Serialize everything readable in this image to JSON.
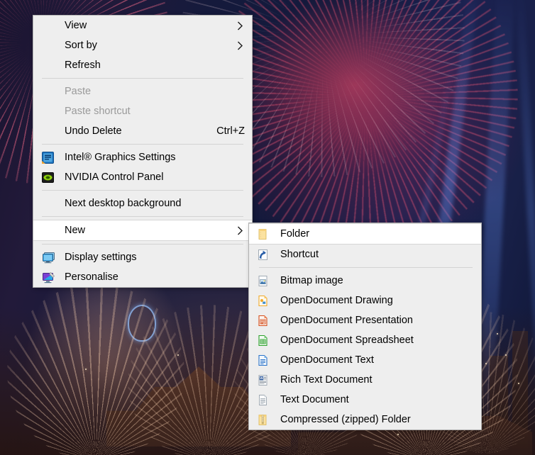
{
  "desktop": {
    "wallpaper_description": "Fireworks over illuminated riverside temple at night",
    "sky_color": "#151a3c",
    "firework_red": "#ff5a78",
    "firework_gold": "#ffd6b4",
    "beam_color": "#6996fa"
  },
  "context_menu": {
    "name": "desktop-context-menu",
    "background": "#eeeeee",
    "border_color": "#b1b1b1",
    "groups": [
      {
        "items": [
          {
            "label": "View",
            "icon": "none",
            "submenu": true,
            "disabled": false,
            "accel": ""
          },
          {
            "label": "Sort by",
            "icon": "none",
            "submenu": true,
            "disabled": false,
            "accel": ""
          },
          {
            "label": "Refresh",
            "icon": "none",
            "submenu": false,
            "disabled": false,
            "accel": ""
          }
        ]
      },
      {
        "items": [
          {
            "label": "Paste",
            "icon": "none",
            "submenu": false,
            "disabled": true,
            "accel": ""
          },
          {
            "label": "Paste shortcut",
            "icon": "none",
            "submenu": false,
            "disabled": true,
            "accel": ""
          },
          {
            "label": "Undo Delete",
            "icon": "none",
            "submenu": false,
            "disabled": false,
            "accel": "Ctrl+Z"
          }
        ]
      },
      {
        "items": [
          {
            "label": "Intel® Graphics Settings",
            "icon": "intel-graphics-icon",
            "submenu": false,
            "disabled": false,
            "accel": ""
          },
          {
            "label": "NVIDIA Control Panel",
            "icon": "nvidia-icon",
            "submenu": false,
            "disabled": false,
            "accel": ""
          }
        ]
      },
      {
        "items": [
          {
            "label": "Next desktop background",
            "icon": "none",
            "submenu": false,
            "disabled": false,
            "accel": ""
          }
        ]
      },
      {
        "items": [
          {
            "label": "New",
            "icon": "none",
            "submenu": true,
            "disabled": false,
            "accel": "",
            "highlighted": true
          }
        ]
      },
      {
        "items": [
          {
            "label": "Display settings",
            "icon": "display-settings-icon",
            "submenu": false,
            "disabled": false,
            "accel": ""
          },
          {
            "label": "Personalise",
            "icon": "personalise-icon",
            "submenu": false,
            "disabled": false,
            "accel": ""
          }
        ]
      }
    ]
  },
  "new_submenu": {
    "name": "new-submenu",
    "background": "#eeeeee",
    "groups": [
      {
        "items": [
          {
            "label": "Folder",
            "icon": "folder-icon",
            "highlighted": true
          },
          {
            "label": "Shortcut",
            "icon": "shortcut-icon",
            "highlighted": false
          }
        ]
      },
      {
        "items": [
          {
            "label": "Bitmap image",
            "icon": "bitmap-image-icon",
            "highlighted": false
          },
          {
            "label": "OpenDocument Drawing",
            "icon": "opendocument-drawing-icon",
            "highlighted": false
          },
          {
            "label": "OpenDocument Presentation",
            "icon": "opendocument-presentation-icon",
            "highlighted": false
          },
          {
            "label": "OpenDocument Spreadsheet",
            "icon": "opendocument-spreadsheet-icon",
            "highlighted": false
          },
          {
            "label": "OpenDocument Text",
            "icon": "opendocument-text-icon",
            "highlighted": false
          },
          {
            "label": "Rich Text Document",
            "icon": "rich-text-document-icon",
            "highlighted": false
          },
          {
            "label": "Text Document",
            "icon": "text-document-icon",
            "highlighted": false
          },
          {
            "label": "Compressed (zipped) Folder",
            "icon": "compressed-folder-icon",
            "highlighted": false
          }
        ]
      }
    ]
  },
  "icon_colors": {
    "folder": "#ffd98a",
    "shortcut_arrow": "#2a5fa8",
    "drawing": "#f5a623",
    "presentation": "#d4501e",
    "spreadsheet": "#2ca02c",
    "odt_text": "#2a72c8",
    "rich_text": "#2b579a",
    "zip": "#f0c84b",
    "intel": "#2a7fc9",
    "nvidia": "#76b900",
    "display": "#41a5ee",
    "personalise": "#8b44d6"
  }
}
